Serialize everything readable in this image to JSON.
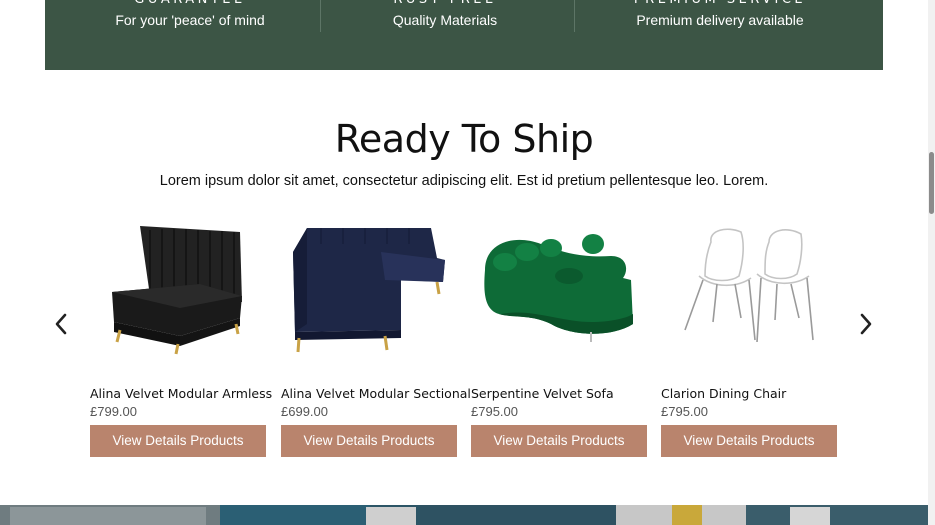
{
  "features": [
    {
      "title": "GUARANTEE",
      "subtitle": "For your 'peace' of mind"
    },
    {
      "title": "RUST FREE",
      "subtitle": "Quality Materials"
    },
    {
      "title": "PREMIUM SERVICE",
      "subtitle": "Premium delivery available"
    }
  ],
  "section": {
    "title": "Ready To Ship",
    "subtitle": "Lorem ipsum dolor sit amet, consectetur adipiscing elit. Est id pretium pellentesque leo. Lorem."
  },
  "carousel": {
    "prev_icon": "chevron-left-icon",
    "next_icon": "chevron-right-icon"
  },
  "products": [
    {
      "name": "Alina Velvet Modular Armless",
      "price": "£799.00",
      "button": "View Details Products",
      "color": "#1b1b1b"
    },
    {
      "name": "Alina Velvet Modular Sectional",
      "price": "£699.00",
      "button": "View Details Products",
      "color": "#1e2747"
    },
    {
      "name": "Serpentine Velvet Sofa",
      "price": "£795.00",
      "button": "View Details Products",
      "color": "#0e6b37"
    },
    {
      "name": "Clarion Dining Chair",
      "price": "£795.00",
      "button": "View Details Products",
      "color": "#cfcfcf"
    }
  ],
  "colors": {
    "banner": "#3c5545",
    "button": "#b9846d"
  }
}
